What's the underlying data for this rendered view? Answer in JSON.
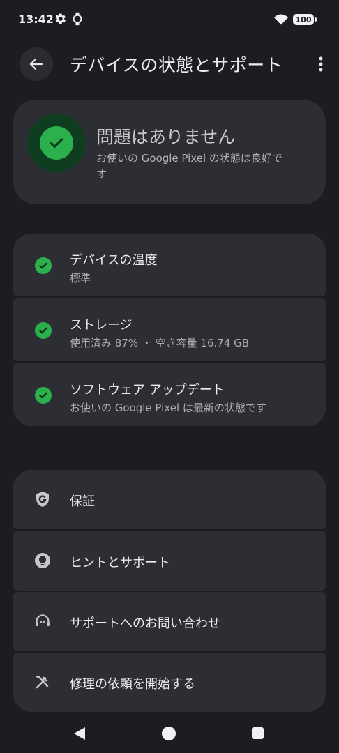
{
  "status_bar": {
    "time": "13:42",
    "battery": "100",
    "icons": [
      "gear-icon",
      "watch-icon",
      "wifi-icon",
      "battery-icon"
    ]
  },
  "header": {
    "title": "デバイスの状態とサポート",
    "back_icon": "arrow-left-icon",
    "menu_icon": "more-vert-icon"
  },
  "summary": {
    "title": "問題はありません",
    "subtitle": "お使いの Google Pixel の状態は良好です",
    "icon": "check-circle-icon"
  },
  "checks": [
    {
      "title": "デバイスの温度",
      "subtitle": "標準",
      "icon": "check-circle-icon"
    },
    {
      "title": "ストレージ",
      "subtitle": "使用済み 87% ・ 空き容量 16.74 GB",
      "icon": "check-circle-icon"
    },
    {
      "title": "ソフトウェア アップデート",
      "subtitle": "お使いの Google Pixel は最新の状態です",
      "icon": "check-circle-icon"
    }
  ],
  "support": [
    {
      "label": "保証",
      "icon": "google-shield-icon"
    },
    {
      "label": "ヒントとサポート",
      "icon": "lightbulb-icon"
    },
    {
      "label": "サポートへのお問い合わせ",
      "icon": "headset-icon"
    },
    {
      "label": "修理の依頼を開始する",
      "icon": "tools-icon"
    }
  ],
  "colors": {
    "background": "#1c1d21",
    "card": "#2c2e34",
    "success": "#2bb04e",
    "success_dark": "#0f3d20"
  }
}
